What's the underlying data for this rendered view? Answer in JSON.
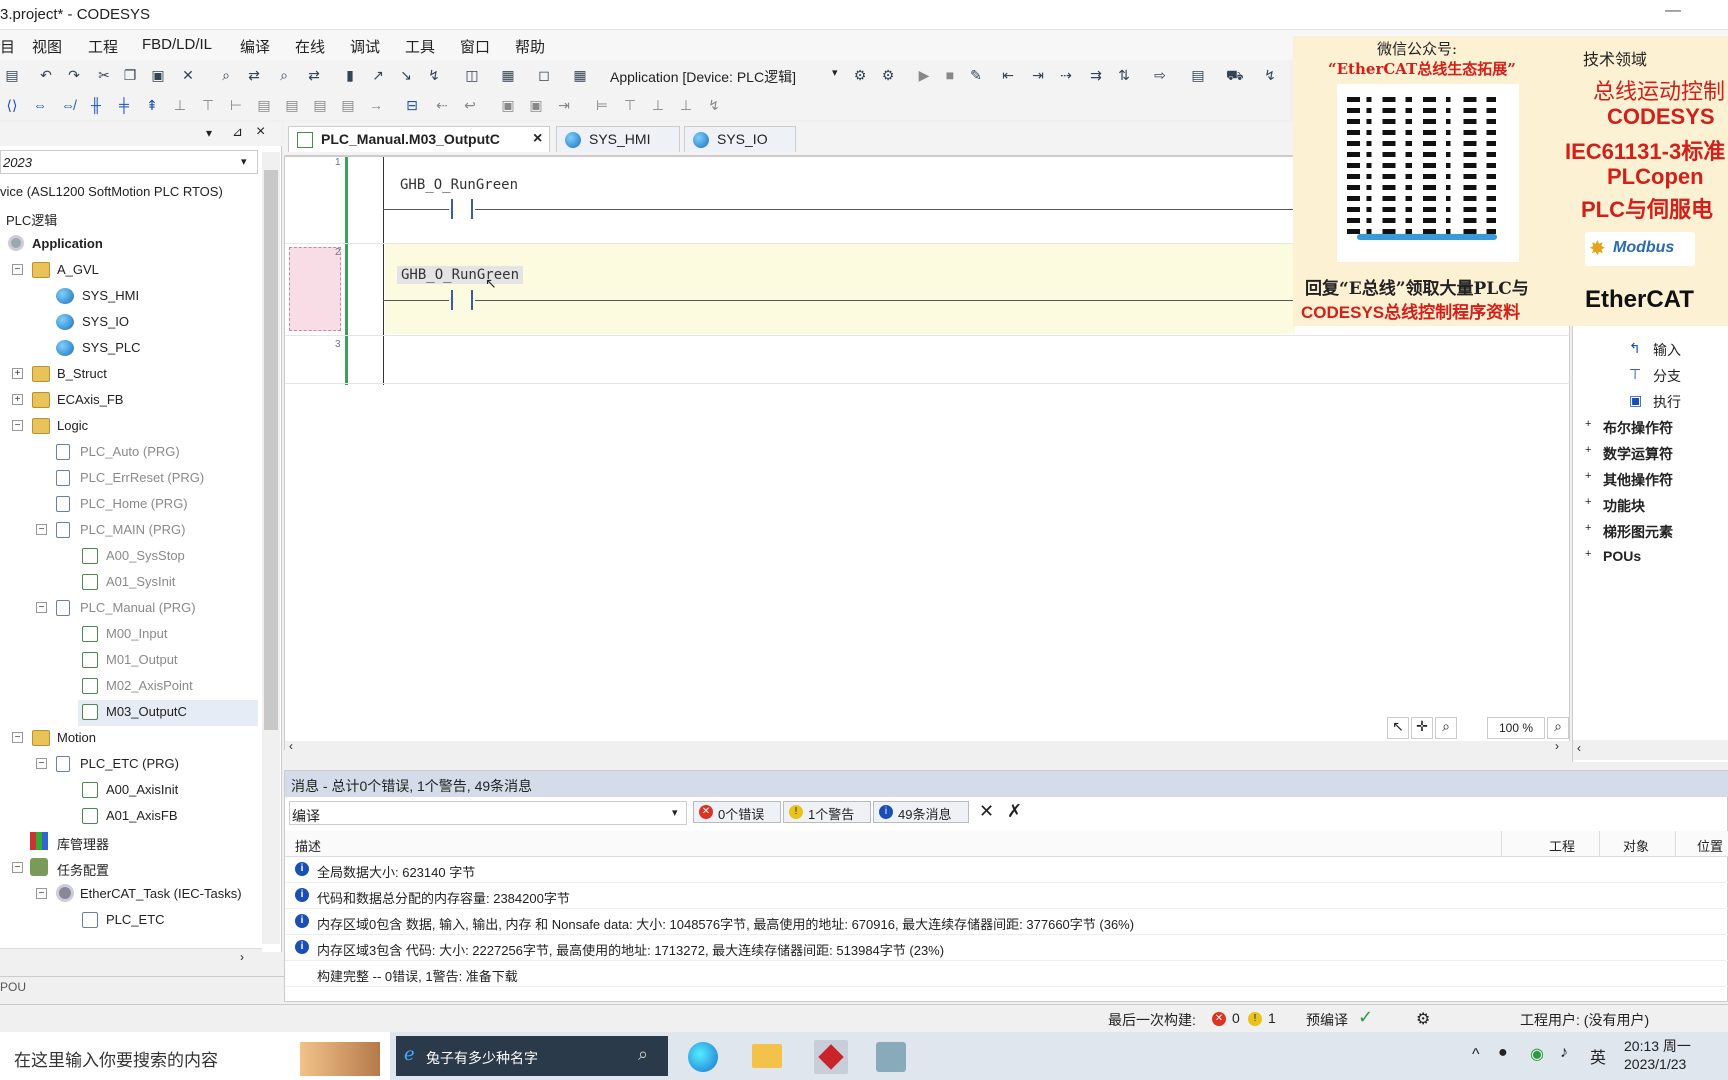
{
  "window": {
    "title": "3.project* - CODESYS",
    "min": "—"
  },
  "menu": [
    "目",
    "视图",
    "工程",
    "FBD/LD/IL",
    "编译",
    "在线",
    "调试",
    "工具",
    "窗口",
    "帮助"
  ],
  "toolbar": {
    "app_selector": "Application [Device: PLC逻辑]"
  },
  "tree": {
    "header": "2023",
    "items": [
      {
        "label": "vice (ASL1200 SoftMotion PLC RTOS)",
        "grey": false
      },
      {
        "label": "PLC逻辑",
        "grey": false
      },
      {
        "label": "Application",
        "grey": false
      },
      {
        "label": "A_GVL",
        "grey": false
      },
      {
        "label": "SYS_HMI",
        "grey": false
      },
      {
        "label": "SYS_IO",
        "grey": false
      },
      {
        "label": "SYS_PLC",
        "grey": false
      },
      {
        "label": "B_Struct",
        "grey": false
      },
      {
        "label": "ECAxis_FB",
        "grey": false
      },
      {
        "label": "Logic",
        "grey": false
      },
      {
        "label": "PLC_Auto (PRG)",
        "grey": true
      },
      {
        "label": "PLC_ErrReset (PRG)",
        "grey": true
      },
      {
        "label": "PLC_Home (PRG)",
        "grey": true
      },
      {
        "label": "PLC_MAIN (PRG)",
        "grey": true
      },
      {
        "label": "A00_SysStop",
        "grey": true
      },
      {
        "label": "A01_SysInit",
        "grey": true
      },
      {
        "label": "PLC_Manual (PRG)",
        "grey": true
      },
      {
        "label": "M00_Input",
        "grey": true
      },
      {
        "label": "M01_Output",
        "grey": true
      },
      {
        "label": "M02_AxisPoint",
        "grey": true
      },
      {
        "label": "M03_OutputC",
        "grey": false
      },
      {
        "label": "Motion",
        "grey": false
      },
      {
        "label": "PLC_ETC (PRG)",
        "grey": false
      },
      {
        "label": "A00_AxisInit",
        "grey": false
      },
      {
        "label": "A01_AxisFB",
        "grey": false
      },
      {
        "label": "库管理器",
        "grey": false
      },
      {
        "label": "任务配置",
        "grey": false
      },
      {
        "label": "EtherCAT_Task (IEC-Tasks)",
        "grey": false
      },
      {
        "label": "PLC_ETC",
        "grey": false
      }
    ],
    "footer": "POU"
  },
  "tabs": [
    {
      "label": "PLC_Manual.M03_OutputC",
      "close": "×"
    },
    {
      "label": "SYS_HMI"
    },
    {
      "label": "SYS_IO"
    }
  ],
  "ladder": {
    "rungs": [
      {
        "num": "1",
        "var": "GHB_O_RunGreen"
      },
      {
        "num": "2",
        "var": "GHB_O_RunGreen"
      },
      {
        "num": "3",
        "var": ""
      }
    ],
    "zoom": "100 %"
  },
  "toolbox": {
    "items": [
      "输入",
      "分支",
      "执行"
    ],
    "groups": [
      "布尔操作符",
      "数学运算符",
      "其他操作符",
      "功能块",
      "梯形图元素",
      "POUs"
    ]
  },
  "overlay": {
    "wechat_title": "微信公众号:",
    "wechat_name": "“EtherCAT总线生态拓展”",
    "reply_line1": "回复“E总线”领取大量PLC与",
    "reply_line2": "CODESYS总线控制程序资料",
    "tech_title": "技术领域",
    "tech_items": [
      "总线运动控制",
      "CODESYS",
      "IEC61131-3标准",
      "PLCopen",
      "PLC与伺服电"
    ],
    "modbus": "Modbus",
    "ethercat": "EtherCAT"
  },
  "messages": {
    "title": "消息 - 总计0个错误, 1个警告, 49条消息",
    "filter": "编译",
    "errors": "0个错误",
    "warnings": "1个警告",
    "infos": "49条消息",
    "columns": [
      "描述",
      "工程",
      "对象",
      "位置"
    ],
    "rows": [
      "全局数据大小: 623140 字节",
      "代码和数据总分配的内存容量: 2384200字节",
      "内存区域0包含 数据, 输入, 输出, 内存 和 Nonsafe data: 大小: 1048576字节, 最高使用的地址: 670916, 最大连续存储器间距: 377660字节 (36%)",
      "内存区域3包含 代码: 大小: 2227256字节, 最高使用的地址: 1713272, 最大连续存储器间距: 513984字节 (23%)",
      "构建完整 -- 0错误, 1警告: 准备下载"
    ]
  },
  "status": {
    "last_build": "最后一次构建:",
    "err": "0",
    "warn": "1",
    "precompile": "预编译",
    "user": "工程用户: (没有用户)"
  },
  "taskbar": {
    "search": "在这里输入你要搜索的内容",
    "browser_tab": "兔子有多少种名字",
    "lang": "英",
    "time": "20:13 周一",
    "date": "2023/1/23"
  }
}
